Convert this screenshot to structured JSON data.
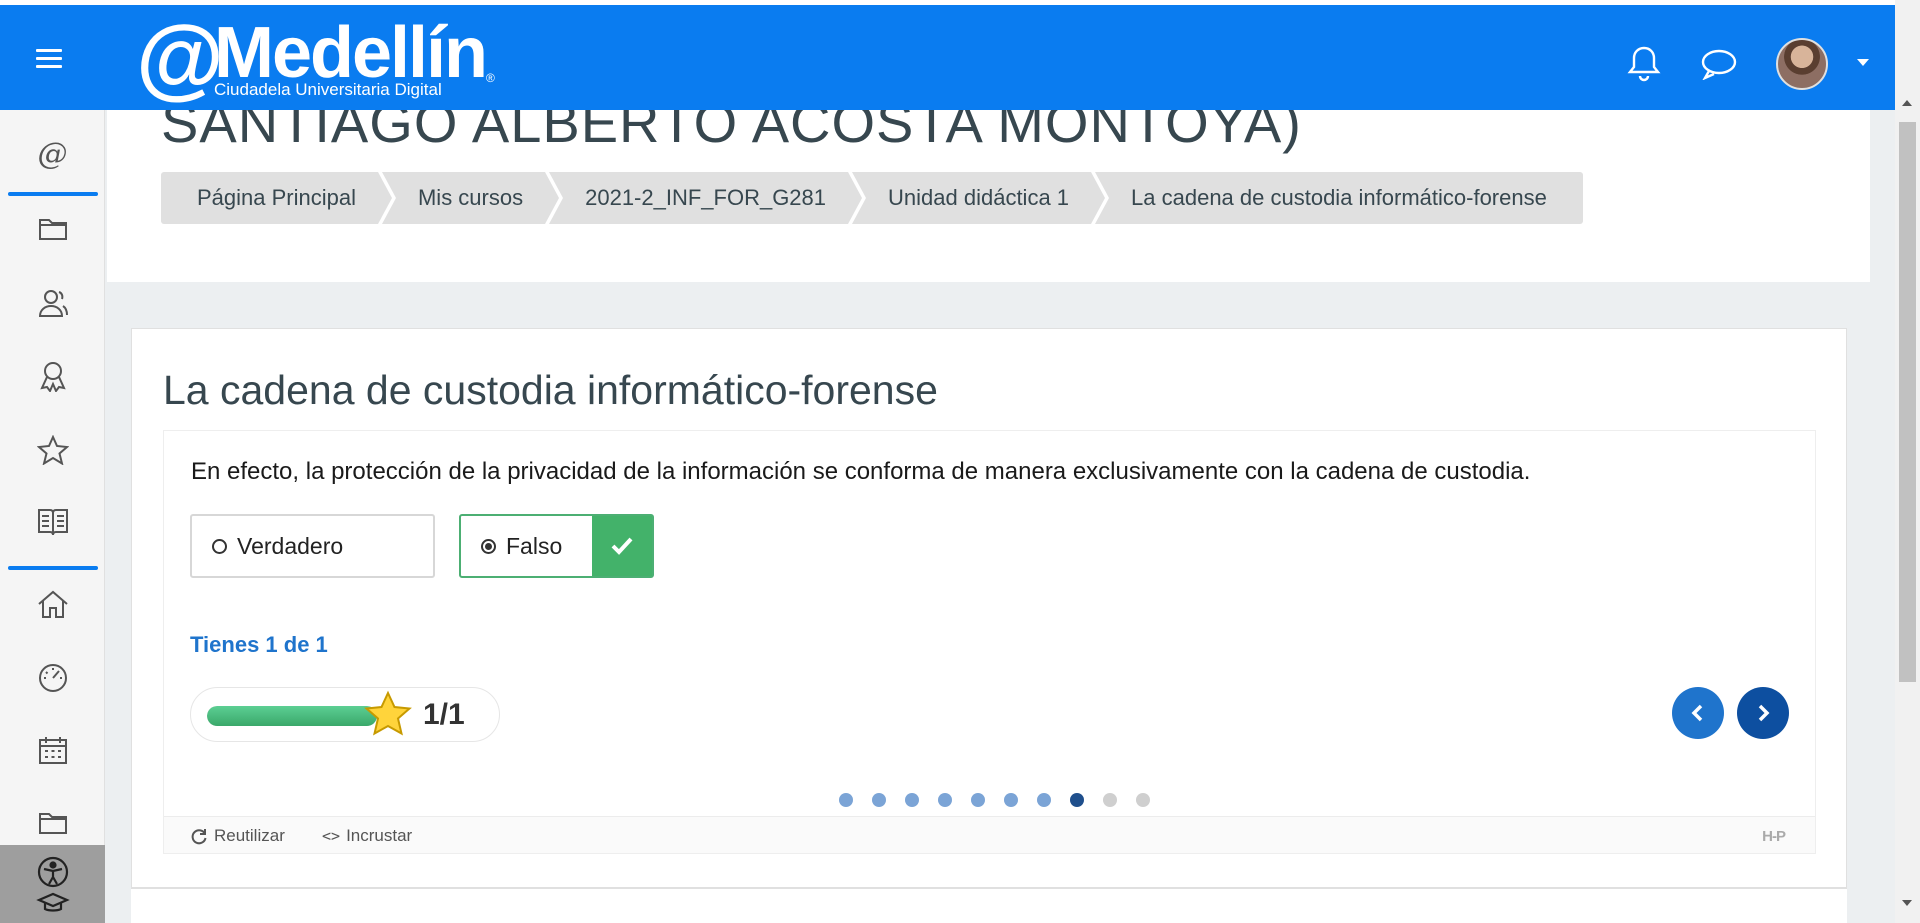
{
  "header": {
    "logo_at": "@",
    "logo_name": "Medellín",
    "logo_reg": "®",
    "logo_sub": "Ciudadela Universitaria Digital"
  },
  "page": {
    "heading": "SANTIAGO ALBERTO ACOSTA MONTOYA)"
  },
  "breadcrumb": [
    {
      "label": "Página Principal"
    },
    {
      "label": "Mis cursos"
    },
    {
      "label": "2021-2_INF_FOR_G281"
    },
    {
      "label": "Unidad didáctica 1"
    },
    {
      "label": "La cadena de custodia informático-forense"
    }
  ],
  "sidebar": {
    "at_symbol": "@",
    "icons": [
      "folder-icon",
      "users-icon",
      "badge-icon",
      "star-icon",
      "book-icon",
      "home-icon",
      "dashboard-icon",
      "calendar-icon",
      "folder-icon",
      "accessibility-icon"
    ]
  },
  "activity": {
    "title": "La cadena de custodia informático-forense",
    "question": "En efecto, la protección de la privacidad de la información se conforma de manera exclusivamente con la cadena de custodia.",
    "answers": [
      {
        "label": "Verdadero",
        "selected": false
      },
      {
        "label": "Falso",
        "selected": true,
        "correct": true
      }
    ],
    "score_text": "Tienes 1 de 1",
    "score_value": "1/1",
    "score_fraction": 1.0,
    "slides_total": 10,
    "slide_current": 8,
    "footer": {
      "reuse_label": "Reutilizar",
      "embed_label": "Incrustar",
      "h5p_logo": "H-P"
    }
  },
  "colors": {
    "topbar": "#0a7cf0",
    "correct": "#43b26a",
    "accent": "#1f74cc"
  }
}
